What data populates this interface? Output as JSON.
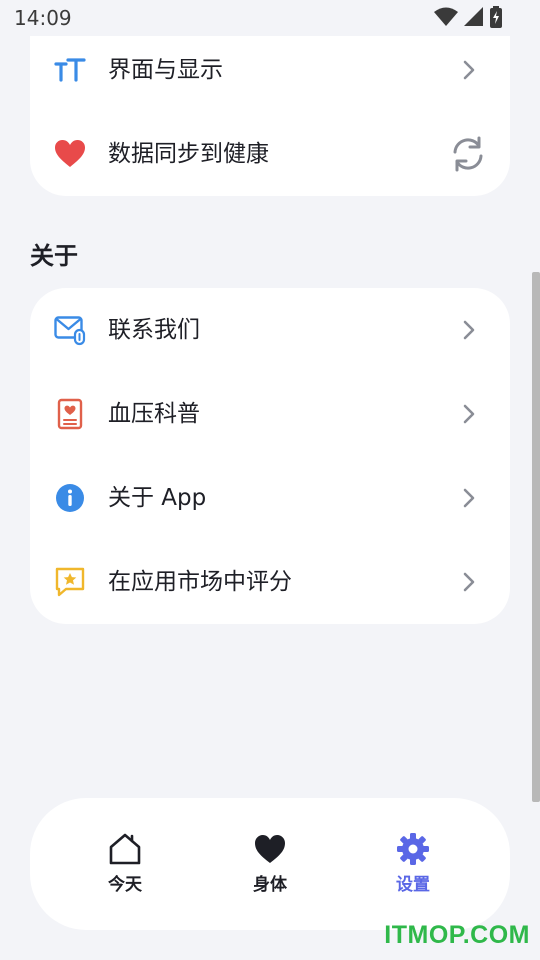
{
  "status_bar": {
    "time": "14:09",
    "icons": [
      "wifi-icon",
      "signal-icon",
      "battery-charging-icon"
    ]
  },
  "settings_top": {
    "items": [
      {
        "label": "界面与显示",
        "icon": "text-size-icon",
        "accent": "#3a8be6"
      },
      {
        "label": "数据同步到健康",
        "icon": "heart-icon",
        "accent": "#e84a4a"
      }
    ]
  },
  "about": {
    "title": "关于",
    "items": [
      {
        "label": "联系我们",
        "icon": "mail-attachment-icon",
        "accent": "#3a8be6"
      },
      {
        "label": "血压科普",
        "icon": "document-heart-icon",
        "accent": "#e0604a"
      },
      {
        "label": "关于 App",
        "icon": "info-icon",
        "accent": "#3a8be6"
      },
      {
        "label": "在应用市场中评分",
        "icon": "star-message-icon",
        "accent": "#f0b72c"
      }
    ]
  },
  "bottom_nav": {
    "items": [
      {
        "label": "今天",
        "icon": "home-icon",
        "active": false
      },
      {
        "label": "身体",
        "icon": "heart-filled-icon",
        "active": false
      },
      {
        "label": "设置",
        "icon": "gear-icon",
        "active": true
      }
    ],
    "active_color": "#5a67e6"
  },
  "watermark": "ITMOP.COM"
}
